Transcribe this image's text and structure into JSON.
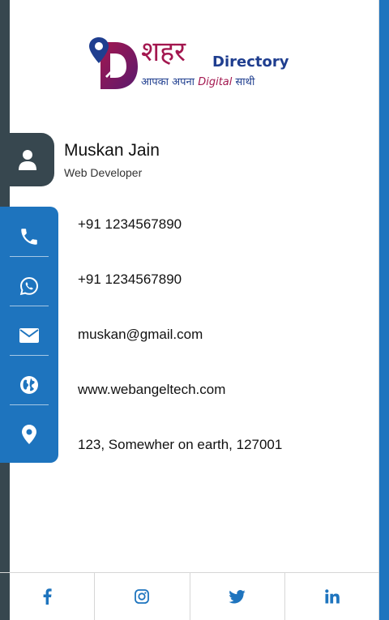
{
  "brand": {
    "hindi_name": "शहर",
    "english_name": "Directory",
    "tagline_prefix": "आपका अपना",
    "tagline_highlight": "Digital",
    "tagline_suffix": "साथी",
    "colors": {
      "primary": "#a3174f",
      "secondary": "#1f3e8f"
    }
  },
  "profile": {
    "name": "Muskan Jain",
    "title": "Web Developer",
    "icon": "user-icon"
  },
  "contacts": [
    {
      "icon": "phone-icon",
      "text": "+91 1234567890"
    },
    {
      "icon": "whatsapp-icon",
      "text": "+91 1234567890"
    },
    {
      "icon": "envelope-icon",
      "text": "muskan@gmail.com"
    },
    {
      "icon": "globe-icon",
      "text": "www.webangeltech.com"
    },
    {
      "icon": "location-pin-icon",
      "text": "123, Somewher on earth, 127001"
    }
  ],
  "social": [
    {
      "name": "facebook",
      "icon": "facebook-icon"
    },
    {
      "name": "instagram",
      "icon": "instagram-icon"
    },
    {
      "name": "twitter",
      "icon": "twitter-icon"
    },
    {
      "name": "linkedin",
      "icon": "linkedin-icon"
    }
  ],
  "colors": {
    "accent": "#1e74be",
    "dark": "#37474f"
  }
}
